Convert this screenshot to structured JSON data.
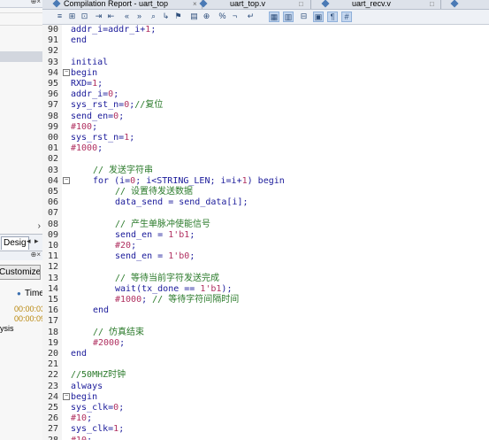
{
  "left_panel": {
    "tab_label": "Desig",
    "customize_label": "Customize...",
    "time_header": "Time",
    "time_values": [
      "00:00:03",
      "00:00:09"
    ],
    "bottom_fragment": "ysis"
  },
  "tabs": [
    {
      "label": "Compilation Report - uart_top"
    },
    {
      "label": "uart_top.v"
    },
    {
      "label": "uart_recv.v"
    }
  ],
  "editor": {
    "lines": [
      {
        "n": "90",
        "indent": 0,
        "fold": false,
        "text": "addr_i=addr_i+1;"
      },
      {
        "n": "91",
        "indent": 0,
        "fold": false,
        "text": "end"
      },
      {
        "n": "92",
        "indent": 0,
        "fold": false,
        "text": ""
      },
      {
        "n": "93",
        "indent": 0,
        "fold": false,
        "text": "initial"
      },
      {
        "n": "94",
        "indent": 0,
        "fold": true,
        "text": "begin"
      },
      {
        "n": "95",
        "indent": 0,
        "fold": false,
        "text": "RXD=1;"
      },
      {
        "n": "96",
        "indent": 0,
        "fold": false,
        "text": "addr_i=0;"
      },
      {
        "n": "97",
        "indent": 0,
        "fold": false,
        "text": "sys_rst_n=0;//复位"
      },
      {
        "n": "98",
        "indent": 0,
        "fold": false,
        "text": "send_en=0;"
      },
      {
        "n": "99",
        "indent": 0,
        "fold": false,
        "text": "#100;"
      },
      {
        "n": "00",
        "indent": 0,
        "fold": false,
        "text": "sys_rst_n=1;"
      },
      {
        "n": "01",
        "indent": 0,
        "fold": false,
        "text": "#1000;"
      },
      {
        "n": "02",
        "indent": 0,
        "fold": false,
        "text": ""
      },
      {
        "n": "03",
        "indent": 1,
        "fold": false,
        "text": "// 发送字符串"
      },
      {
        "n": "04",
        "indent": 1,
        "fold": true,
        "text": "for (i=0; i<STRING_LEN; i=i+1) begin"
      },
      {
        "n": "05",
        "indent": 2,
        "fold": false,
        "text": "// 设置待发送数据"
      },
      {
        "n": "06",
        "indent": 2,
        "fold": false,
        "text": "data_send = send_data[i];"
      },
      {
        "n": "07",
        "indent": 0,
        "fold": false,
        "text": ""
      },
      {
        "n": "08",
        "indent": 2,
        "fold": false,
        "text": "// 产生单脉冲使能信号"
      },
      {
        "n": "09",
        "indent": 2,
        "fold": false,
        "text": "send_en = 1'b1;"
      },
      {
        "n": "10",
        "indent": 2,
        "fold": false,
        "text": "#20;"
      },
      {
        "n": "11",
        "indent": 2,
        "fold": false,
        "text": "send_en = 1'b0;"
      },
      {
        "n": "12",
        "indent": 0,
        "fold": false,
        "text": ""
      },
      {
        "n": "13",
        "indent": 2,
        "fold": false,
        "text": "// 等待当前字符发送完成"
      },
      {
        "n": "14",
        "indent": 2,
        "fold": false,
        "text": "wait(tx_done == 1'b1);"
      },
      {
        "n": "15",
        "indent": 2,
        "fold": false,
        "text": "#1000; // 等待字符间隔时间"
      },
      {
        "n": "16",
        "indent": 1,
        "fold": false,
        "text": "end"
      },
      {
        "n": "17",
        "indent": 0,
        "fold": false,
        "text": ""
      },
      {
        "n": "18",
        "indent": 1,
        "fold": false,
        "text": "// 仿真结束"
      },
      {
        "n": "19",
        "indent": 1,
        "fold": false,
        "text": "#2000;"
      },
      {
        "n": "20",
        "indent": 0,
        "fold": false,
        "text": "end"
      },
      {
        "n": "21",
        "indent": 0,
        "fold": false,
        "text": ""
      },
      {
        "n": "22",
        "indent": 0,
        "fold": false,
        "text": "//50MHZ时钟"
      },
      {
        "n": "23",
        "indent": 0,
        "fold": false,
        "text": "always"
      },
      {
        "n": "24",
        "indent": 0,
        "fold": true,
        "text": "begin"
      },
      {
        "n": "25",
        "indent": 0,
        "fold": false,
        "text": "sys_clk=0;"
      },
      {
        "n": "26",
        "indent": 0,
        "fold": false,
        "text": "#10;"
      },
      {
        "n": "27",
        "indent": 0,
        "fold": false,
        "text": "sys_clk=1;"
      },
      {
        "n": "28",
        "indent": 0,
        "fold": false,
        "text": "#10;"
      },
      {
        "n": "29",
        "indent": 0,
        "fold": false,
        "text": "end"
      }
    ]
  }
}
